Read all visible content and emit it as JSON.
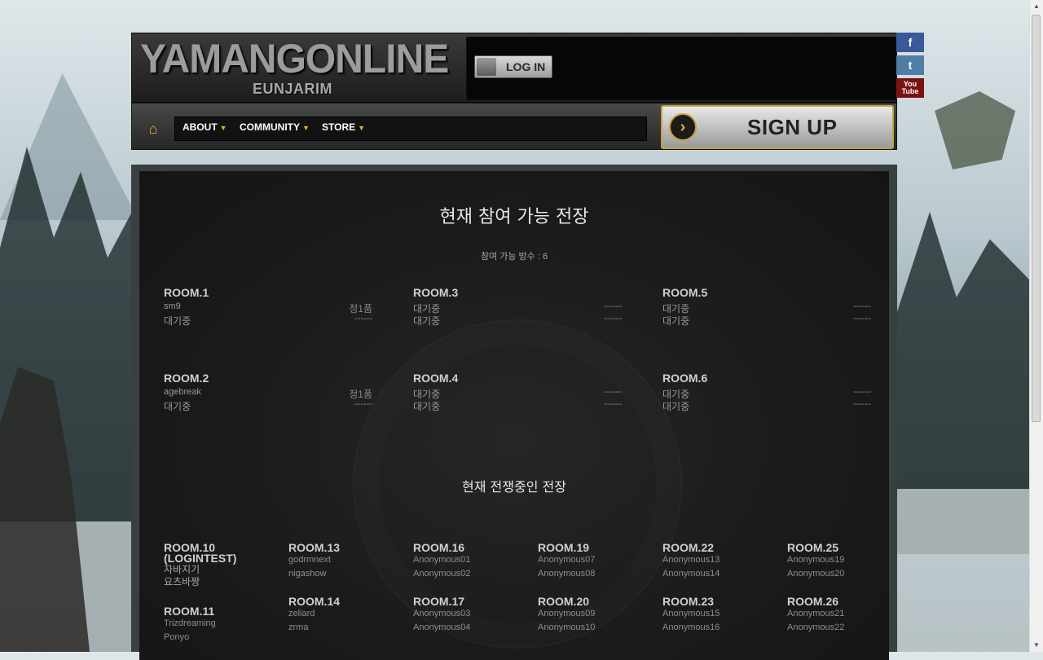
{
  "brand": {
    "title": "YAMANGONLINE",
    "subtitle": "EUNJARIM"
  },
  "header": {
    "login_label": "LOG IN",
    "signup_label": "SIGN UP"
  },
  "social": {
    "facebook": "f",
    "twitter": "t",
    "youtube": "You Tube"
  },
  "nav": {
    "home_icon": "home-icon",
    "items": [
      {
        "label": "ABOUT"
      },
      {
        "label": "COMMUNITY"
      },
      {
        "label": "STORE"
      }
    ]
  },
  "available": {
    "title": "현재 참여 가능 전장",
    "count_label": "참여 가능 방수 : 6",
    "rooms": [
      {
        "name": "ROOM.1",
        "p1": "sm9",
        "p1_status": "정1품",
        "p2": "대기중",
        "p2_status": "------"
      },
      {
        "name": "ROOM.2",
        "p1": "agebreak",
        "p1_status": "정1품",
        "p2": "대기중",
        "p2_status": "------"
      },
      {
        "name": "ROOM.3",
        "p1": "대기중",
        "p1_status": "------",
        "p2": "대기중",
        "p2_status": "------"
      },
      {
        "name": "ROOM.4",
        "p1": "대기중",
        "p1_status": "------",
        "p2": "대기중",
        "p2_status": "------"
      },
      {
        "name": "ROOM.5",
        "p1": "대기중",
        "p1_status": "------",
        "p2": "대기중",
        "p2_status": "------"
      },
      {
        "name": "ROOM.6",
        "p1": "대기중",
        "p1_status": "------",
        "p2": "대기중",
        "p2_status": "------"
      }
    ]
  },
  "battle": {
    "title": "현재 전쟁중인 전장",
    "rooms": [
      {
        "name": "ROOM.10 (LOGINTEST)",
        "p1": "자바지기",
        "p2": "요츠바짱"
      },
      {
        "name": "ROOM.11",
        "p1": "Trizdreaming",
        "p2": "Ponyo"
      },
      {
        "name": "ROOM.13",
        "p1": "godrmnext",
        "p2": "nigashow"
      },
      {
        "name": "ROOM.14",
        "p1": "zeliard",
        "p2": "zrma"
      },
      {
        "name": "ROOM.16",
        "p1": "Anonymous01",
        "p2": "Anonymous02"
      },
      {
        "name": "ROOM.17",
        "p1": "Anonymous03",
        "p2": "Anonymous04"
      },
      {
        "name": "ROOM.19",
        "p1": "Anonymous07",
        "p2": "Anonymous08"
      },
      {
        "name": "ROOM.20",
        "p1": "Anonymous09",
        "p2": "Anonymous10"
      },
      {
        "name": "ROOM.22",
        "p1": "Anonymous13",
        "p2": "Anonymous14"
      },
      {
        "name": "ROOM.23",
        "p1": "Anonymous15",
        "p2": "Anonymous16"
      },
      {
        "name": "ROOM.25",
        "p1": "Anonymous19",
        "p2": "Anonymous20"
      },
      {
        "name": "ROOM.26",
        "p1": "Anonymous21",
        "p2": "Anonymous22"
      }
    ]
  }
}
